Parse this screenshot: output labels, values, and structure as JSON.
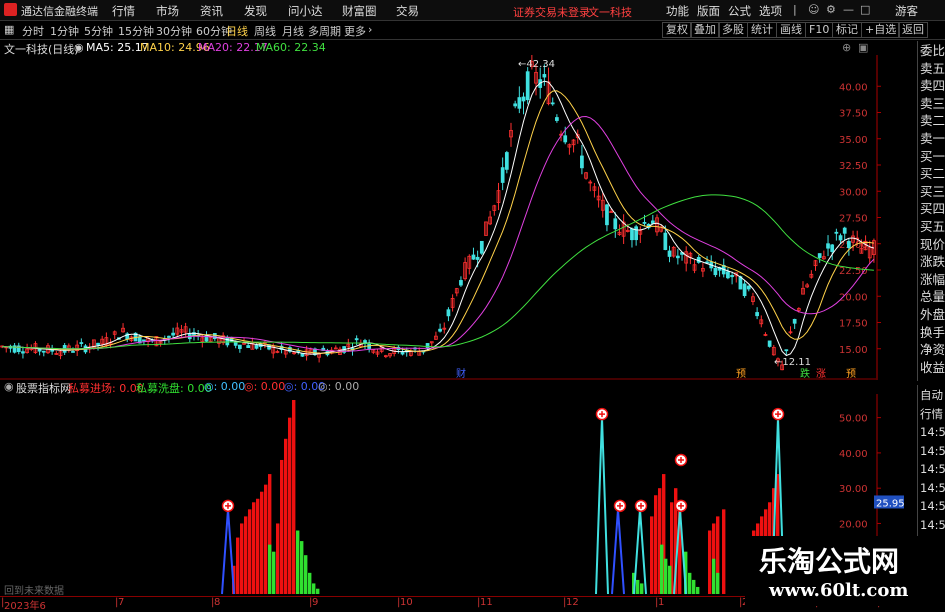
{
  "menubar": {
    "app_title": "通达信金融终端",
    "items": [
      "行情",
      "市场",
      "资讯",
      "发现",
      "问小达",
      "财富圈",
      "交易"
    ],
    "warning": "证券交易未登录",
    "stock_name": "文一科技",
    "right_items": [
      "功能",
      "版面",
      "公式",
      "选项"
    ],
    "guest": "游客"
  },
  "toolbar": {
    "periods": [
      "分时",
      "1分钟",
      "5分钟",
      "15分钟",
      "30分钟",
      "60分钟",
      "日线",
      "周线",
      "月线",
      "多周期",
      "更多"
    ],
    "active_period": "日线",
    "right_buttons": [
      "复权",
      "叠加",
      "多股",
      "统计",
      "画线",
      "F10",
      "标记",
      "+自选",
      "返回"
    ]
  },
  "main_legend": {
    "title": "文一科技(日线)",
    "ma5": "MA5: 25.17",
    "ma10": "MA10: 24.96",
    "ma20": "MA20: 22.17",
    "ma60": "MA60: 22.34",
    "colors": {
      "ma5": "#ffffff",
      "ma10": "#ffd24a",
      "ma20": "#e040e0",
      "ma60": "#40e040"
    }
  },
  "main_axis": {
    "ticks": [
      "40.00",
      "37.50",
      "35.00",
      "32.50",
      "30.00",
      "27.50",
      "25.00",
      "22.50",
      "20.00",
      "17.50",
      "15.00"
    ],
    "tick_values": [
      40,
      37.5,
      35,
      32.5,
      30,
      27.5,
      25,
      22.5,
      20,
      17.5,
      15
    ],
    "ylim": [
      12.5,
      42.5
    ],
    "high_label": "42.34",
    "low_label": "12.11",
    "markers": [
      "财",
      "预",
      "跌",
      "涨",
      "预"
    ]
  },
  "side_panel": {
    "items": [
      "委比",
      "卖五",
      "卖四",
      "卖三",
      "卖二",
      "卖一",
      "买一",
      "买二",
      "买三",
      "买四",
      "买五",
      "现价",
      "涨跌",
      "涨幅",
      "总量",
      "外盘",
      "换手",
      "净资",
      "收益"
    ],
    "items2": [
      "自动",
      "行情",
      "14:50",
      "14:50",
      "14:50",
      "14:50",
      "14:50",
      "14:50",
      "14:50",
      "14:50"
    ]
  },
  "sub_legend": {
    "title": "股票指标网",
    "items": [
      {
        "label": "私募进场: 0.00",
        "color": "#ff3030"
      },
      {
        "label": "私募洗盘: 0.00",
        "color": "#30e030"
      },
      {
        "label": "◎: 0.00",
        "color": "#40c0ff"
      },
      {
        "label": "◎: 0.00",
        "color": "#ff3030"
      },
      {
        "label": "◎: 0.00",
        "color": "#4060ff"
      },
      {
        "label": "◎: 0.00",
        "color": "#aaaaaa"
      }
    ]
  },
  "sub_axis": {
    "ticks": [
      "50.00",
      "40.00",
      "30.00",
      "20.00"
    ],
    "tick_values": [
      50,
      40,
      30,
      20
    ],
    "ylim": [
      0,
      55
    ],
    "current_value": "25.95"
  },
  "date_axis": {
    "labels": [
      "2023年6",
      "7",
      "8",
      "9",
      "10",
      "11",
      "12",
      "1",
      "2",
      "3",
      "4"
    ]
  },
  "watermark": {
    "line1": "乐淘公式网",
    "line2": "www.60lt.com"
  },
  "no_future_data": "回到未来数据",
  "chart_data": {
    "type": "candlestick",
    "title": "文一科技(日线)",
    "price_range": [
      12.11,
      42.34
    ],
    "key_points": [
      {
        "date": "2023-06",
        "close": 14.5
      },
      {
        "date": "2023-07",
        "close": 16.0
      },
      {
        "date": "2023-08",
        "close": 15.5
      },
      {
        "date": "2023-09",
        "close": 14.5
      },
      {
        "date": "2023-10",
        "close": 15.0
      },
      {
        "date": "2023-11",
        "close": 18.5
      },
      {
        "date": "2023-11-end",
        "close": 42.34
      },
      {
        "date": "2023-12",
        "close": 33.0
      },
      {
        "date": "2024-01",
        "close": 27.0
      },
      {
        "date": "2024-02",
        "close": 22.0
      },
      {
        "date": "2024-03-low",
        "close": 12.11
      },
      {
        "date": "2024-04",
        "close": 25.17
      }
    ],
    "indicator": {
      "name": "股票指标网",
      "series": [
        {
          "name": "私募进场",
          "color": "#ff3030"
        },
        {
          "name": "私募洗盘",
          "color": "#30e030"
        }
      ]
    }
  }
}
